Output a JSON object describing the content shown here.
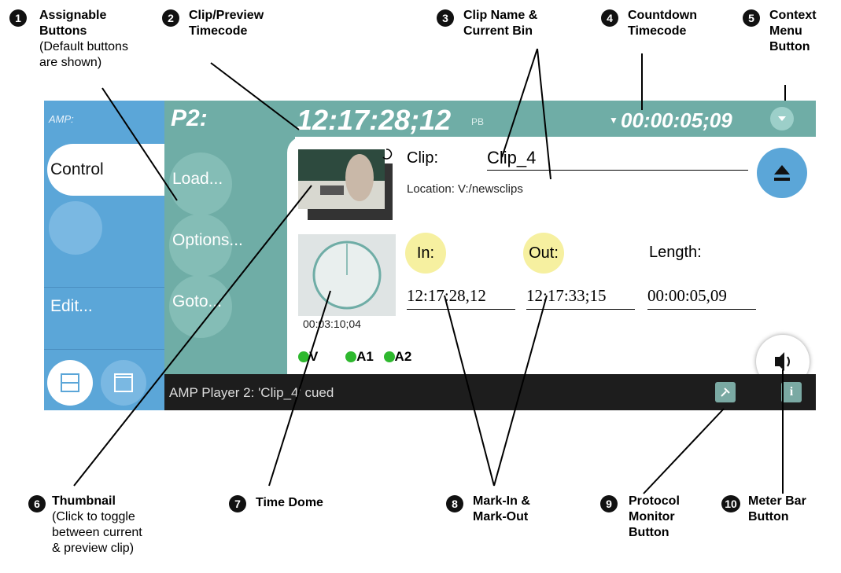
{
  "callouts": [
    {
      "num": "1",
      "title": "Assignable\nButtons",
      "sub": "(Default buttons\nare shown)"
    },
    {
      "num": "2",
      "title": "Clip/Preview\nTimecode",
      "sub": ""
    },
    {
      "num": "3",
      "title": "Clip Name &\nCurrent Bin",
      "sub": ""
    },
    {
      "num": "4",
      "title": "Countdown\nTimecode",
      "sub": ""
    },
    {
      "num": "5",
      "title": "Context\nMenu\nButton",
      "sub": ""
    },
    {
      "num": "6",
      "title": "Thumbnail",
      "sub": "(Click to toggle\nbetween current\n& preview clip)"
    },
    {
      "num": "7",
      "title": "Time Dome",
      "sub": ""
    },
    {
      "num": "8",
      "title": "Mark-In &\nMark-Out",
      "sub": ""
    },
    {
      "num": "9",
      "title": "Protocol\nMonitor\nButton",
      "sub": ""
    },
    {
      "num": "10",
      "title": "Meter Bar\nButton",
      "sub": ""
    }
  ],
  "ui": {
    "sidebar": {
      "amp": "AMP:",
      "control": "Control",
      "edit": "Edit..."
    },
    "topbar": {
      "player": "P2:",
      "timecode": "12:17:28;12",
      "pb": "PB",
      "countdown": "00:00:05;09"
    },
    "assignable": [
      "Load...",
      "Options...",
      "Goto..."
    ],
    "clip": {
      "label": "Clip:",
      "name": "Clip_4",
      "location": "Location:  V:/newsclips"
    },
    "dome_time": "00:03:10;04",
    "marks": {
      "in_label": "In:",
      "out_label": "Out:",
      "length_label": "Length:",
      "in_tc": "12:17:28,12",
      "out_tc": "12:17:33;15",
      "length_tc": "00:00:05,09"
    },
    "tracks": [
      "V",
      "A1",
      "A2"
    ],
    "status": "AMP Player 2: 'Clip_4' cued",
    "colors": {
      "teal": "#6fada6",
      "blue": "#5ba6d8",
      "mark": "#f6f0a0",
      "led": "#2eb82e"
    }
  }
}
